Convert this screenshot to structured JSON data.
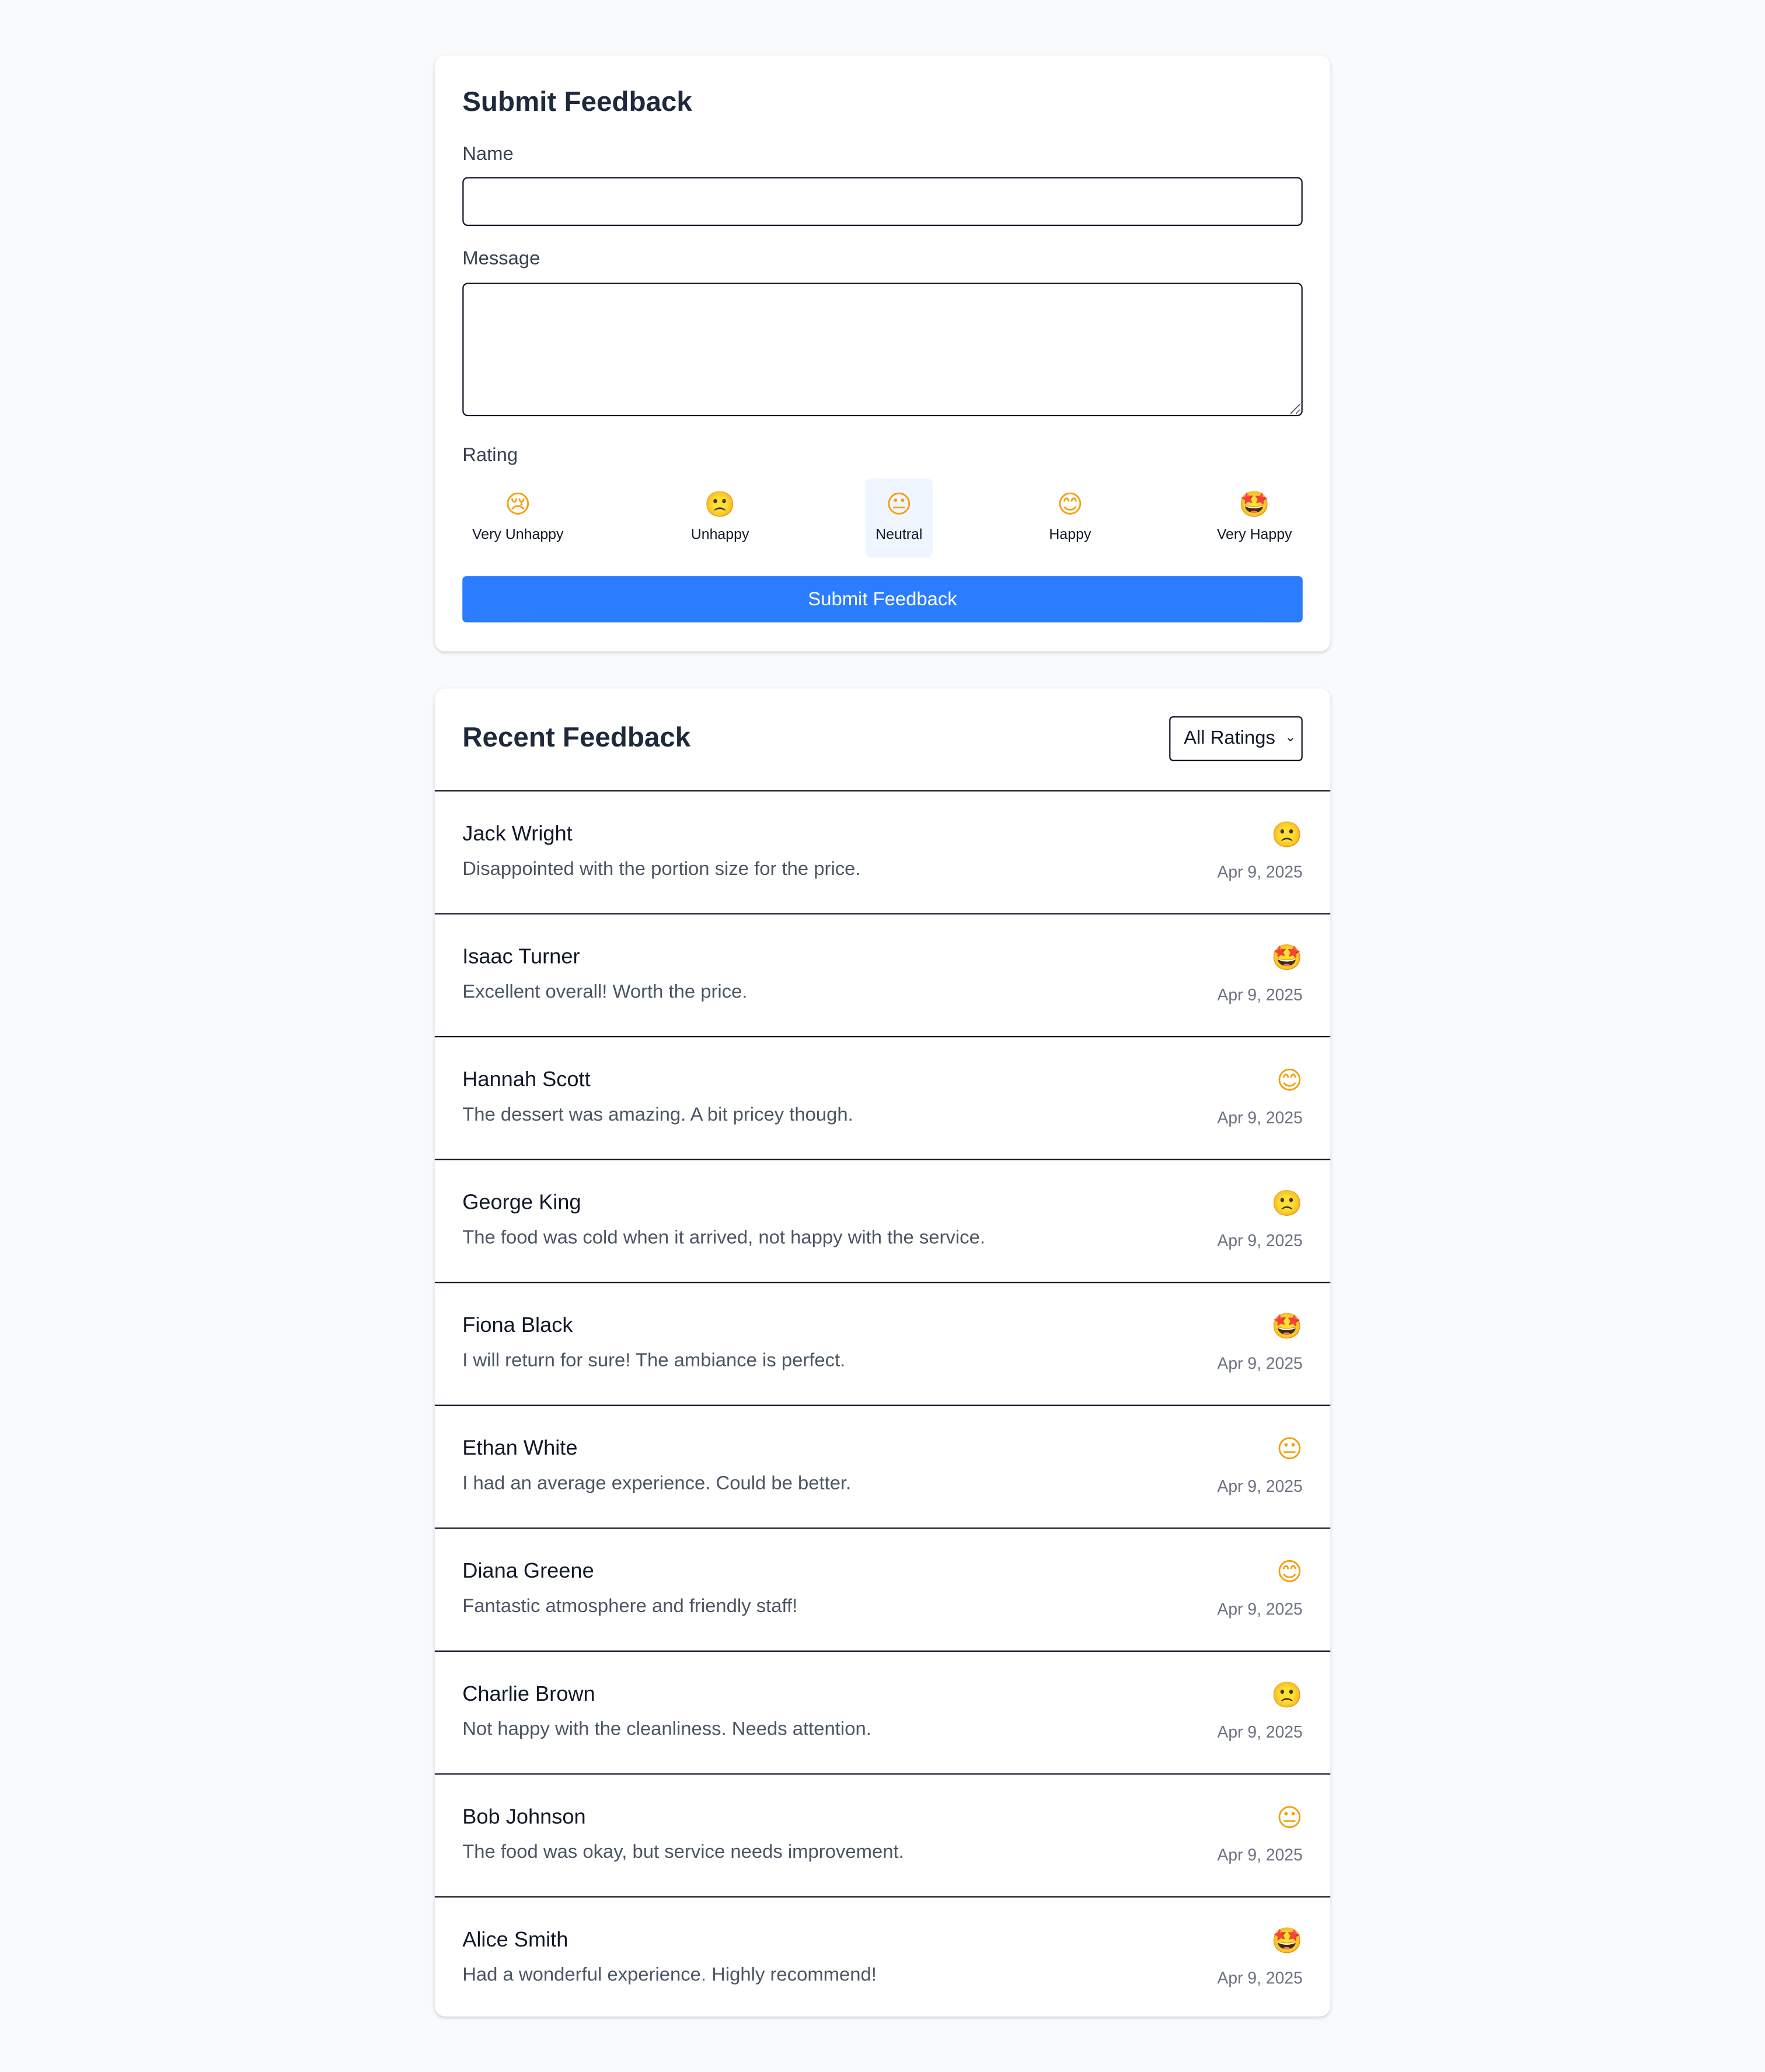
{
  "form": {
    "title": "Submit Feedback",
    "name_label": "Name",
    "name_value": "",
    "message_label": "Message",
    "message_value": "",
    "rating_label": "Rating",
    "rating_options": [
      {
        "emoji": "😢",
        "label": "Very Unhappy",
        "icon": "crying-face-icon"
      },
      {
        "emoji": "🙁",
        "label": "Unhappy",
        "icon": "slightly-frowning-face-icon"
      },
      {
        "emoji": "😐",
        "label": "Neutral",
        "icon": "neutral-face-icon"
      },
      {
        "emoji": "😊",
        "label": "Happy",
        "icon": "smiling-face-icon"
      },
      {
        "emoji": "🤩",
        "label": "Very Happy",
        "icon": "star-struck-face-icon"
      }
    ],
    "selected_rating": "Neutral",
    "submit_label": "Submit Feedback"
  },
  "list": {
    "title": "Recent Feedback",
    "filter_value": "All Ratings",
    "items": [
      {
        "name": "Jack Wright",
        "message": "Disappointed with the portion size for the price.",
        "emoji": "🙁",
        "date": "Apr 9, 2025"
      },
      {
        "name": "Isaac Turner",
        "message": "Excellent overall! Worth the price.",
        "emoji": "🤩",
        "date": "Apr 9, 2025"
      },
      {
        "name": "Hannah Scott",
        "message": "The dessert was amazing. A bit pricey though.",
        "emoji": "😊",
        "date": "Apr 9, 2025"
      },
      {
        "name": "George King",
        "message": "The food was cold when it arrived, not happy with the service.",
        "emoji": "🙁",
        "date": "Apr 9, 2025"
      },
      {
        "name": "Fiona Black",
        "message": "I will return for sure! The ambiance is perfect.",
        "emoji": "🤩",
        "date": "Apr 9, 2025"
      },
      {
        "name": "Ethan White",
        "message": "I had an average experience. Could be better.",
        "emoji": "😐",
        "date": "Apr 9, 2025"
      },
      {
        "name": "Diana Greene",
        "message": "Fantastic atmosphere and friendly staff!",
        "emoji": "😊",
        "date": "Apr 9, 2025"
      },
      {
        "name": "Charlie Brown",
        "message": "Not happy with the cleanliness. Needs attention.",
        "emoji": "🙁",
        "date": "Apr 9, 2025"
      },
      {
        "name": "Bob Johnson",
        "message": "The food was okay, but service needs improvement.",
        "emoji": "😐",
        "date": "Apr 9, 2025"
      },
      {
        "name": "Alice Smith",
        "message": "Had a wonderful experience. Highly recommend!",
        "emoji": "🤩",
        "date": "Apr 9, 2025"
      }
    ]
  },
  "colors": {
    "accent": "#2b7cff",
    "selected_bg": "#eff6ff",
    "page_bg": "#f8fafc"
  }
}
